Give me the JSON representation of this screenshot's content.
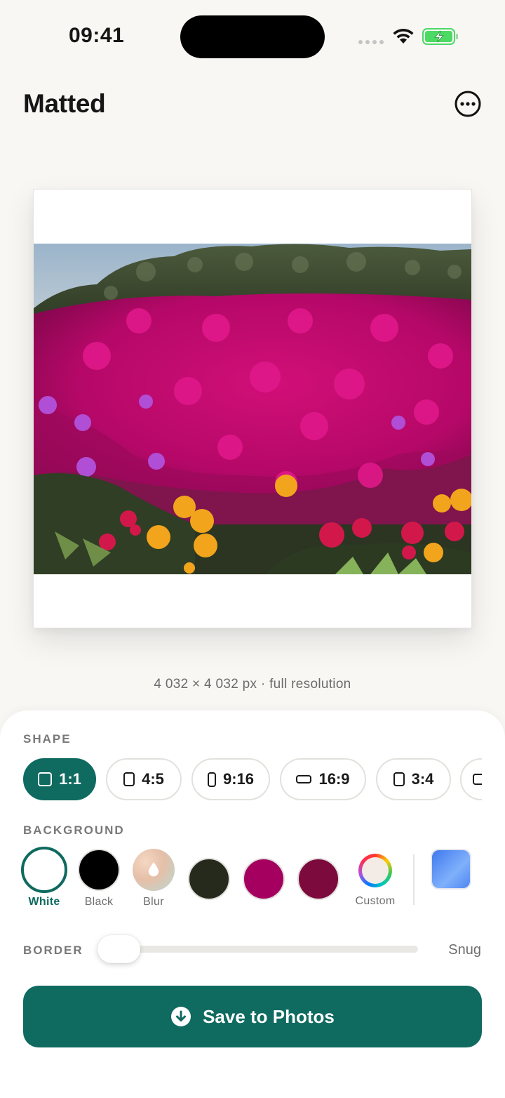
{
  "status_bar": {
    "time": "09:41"
  },
  "header": {
    "title": "Matted",
    "more_icon": "ellipsis-circle-icon"
  },
  "preview": {
    "resolution": "4 032 × 4 032 px · full resolution"
  },
  "shape": {
    "label": "SHAPE",
    "options": [
      {
        "label": "1:1",
        "selected": true
      },
      {
        "label": "4:5",
        "selected": false
      },
      {
        "label": "9:16",
        "selected": false
      },
      {
        "label": "16:9",
        "selected": false
      },
      {
        "label": "3:4",
        "selected": false
      },
      {
        "label": "",
        "selected": false
      }
    ]
  },
  "background": {
    "label": "BACKGROUND",
    "swatches": [
      {
        "label": "White",
        "color": "#ffffff",
        "selected": true
      },
      {
        "label": "Black",
        "color": "#000000",
        "selected": false
      },
      {
        "label": "Blur",
        "color": "#e8c6b0",
        "selected": false
      },
      {
        "label": "",
        "color": "#262a1c",
        "selected": false
      },
      {
        "label": "",
        "color": "#a50060",
        "selected": false
      },
      {
        "label": "",
        "color": "#7c0a3c",
        "selected": false
      },
      {
        "label": "Custom",
        "color": "#f3ece6",
        "selected": false
      }
    ],
    "extra_swatch_color": "#5c92f6"
  },
  "border": {
    "label": "BORDER",
    "value": "Snug",
    "level": 0
  },
  "save": {
    "label": "Save to Photos",
    "icon": "download-circle-icon"
  },
  "colors": {
    "accent": "#0f6a60",
    "background": "#f8f7f4"
  }
}
